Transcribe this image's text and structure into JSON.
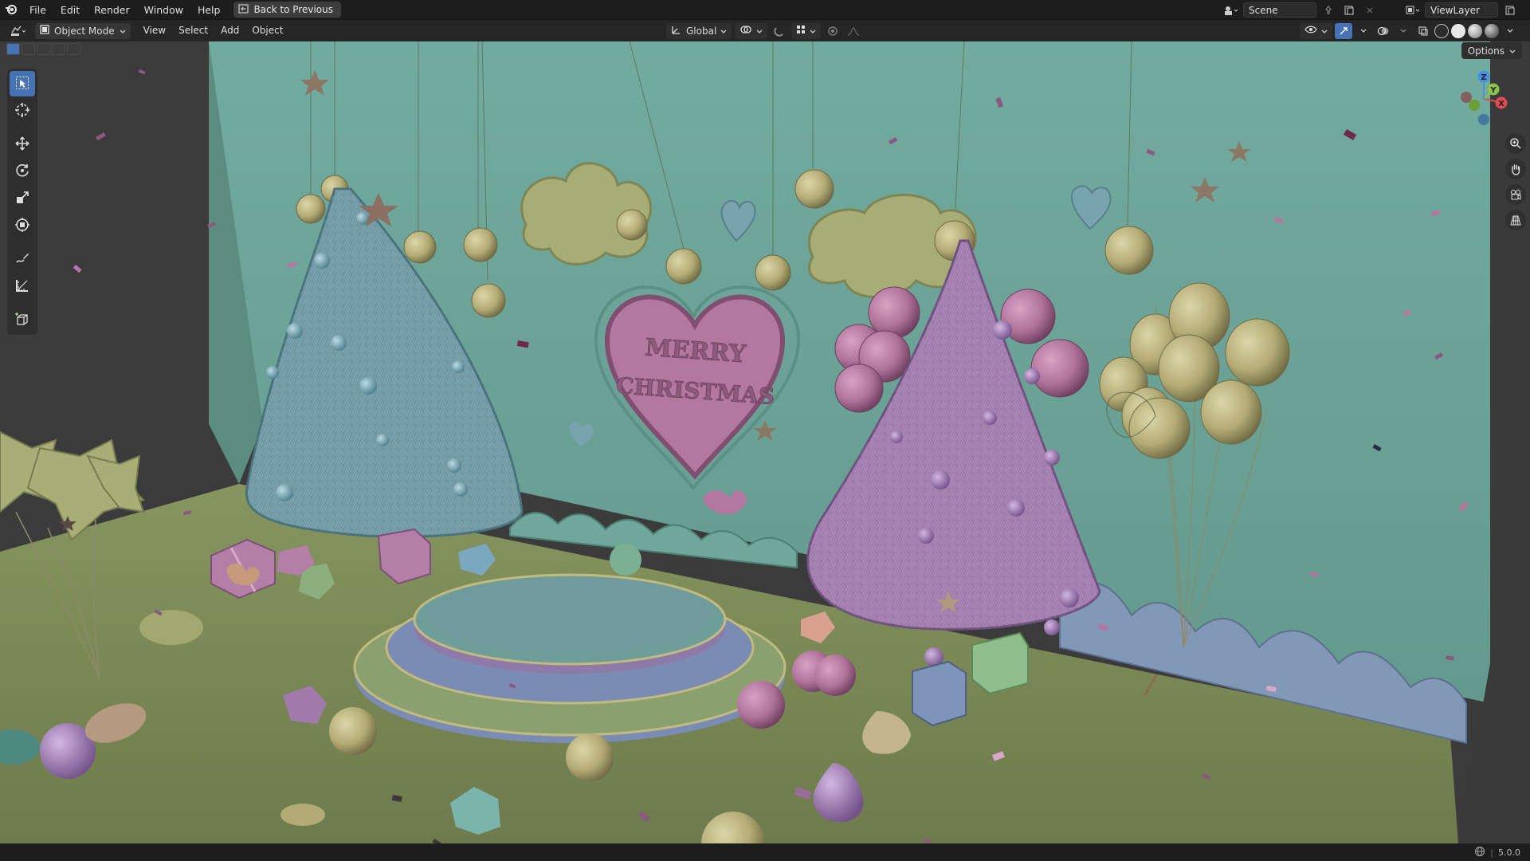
{
  "topbar": {
    "menus": [
      "File",
      "Edit",
      "Render",
      "Window",
      "Help"
    ],
    "back_label": "Back to Previous",
    "scene_name": "Scene",
    "viewlayer_name": "ViewLayer"
  },
  "header": {
    "mode_label": "Object Mode",
    "menus": [
      "View",
      "Select",
      "Add",
      "Object"
    ],
    "orientation_label": "Global",
    "options_label": "Options"
  },
  "viewport": {
    "sign_line1": "MERRY",
    "sign_line2": "CHRISTMAS"
  },
  "gizmo": {
    "x": "X",
    "y": "Y",
    "z": "Z"
  },
  "statusbar": {
    "version": "5.0.0"
  },
  "colors": {
    "accent": "#4772b3",
    "wall": "#6fa79b",
    "floor": "#7b8a5a",
    "tree_left": "#6f98a3",
    "tree_right": "#a07bab"
  }
}
